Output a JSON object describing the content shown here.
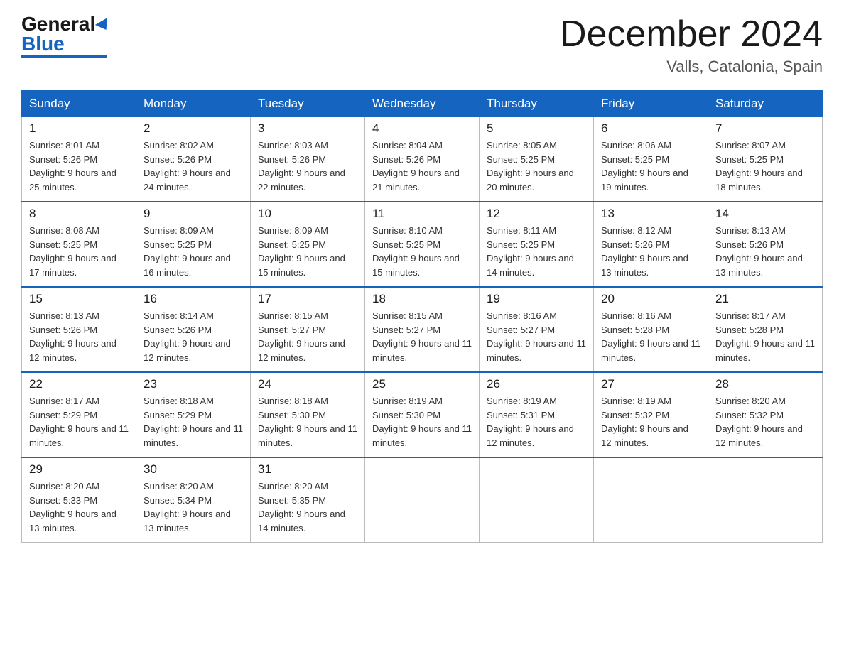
{
  "header": {
    "logo_general": "General",
    "logo_blue": "Blue",
    "month_title": "December 2024",
    "location": "Valls, Catalonia, Spain"
  },
  "weekdays": [
    "Sunday",
    "Monday",
    "Tuesday",
    "Wednesday",
    "Thursday",
    "Friday",
    "Saturday"
  ],
  "weeks": [
    [
      {
        "day": "1",
        "sunrise": "8:01 AM",
        "sunset": "5:26 PM",
        "daylight": "9 hours and 25 minutes."
      },
      {
        "day": "2",
        "sunrise": "8:02 AM",
        "sunset": "5:26 PM",
        "daylight": "9 hours and 24 minutes."
      },
      {
        "day": "3",
        "sunrise": "8:03 AM",
        "sunset": "5:26 PM",
        "daylight": "9 hours and 22 minutes."
      },
      {
        "day": "4",
        "sunrise": "8:04 AM",
        "sunset": "5:26 PM",
        "daylight": "9 hours and 21 minutes."
      },
      {
        "day": "5",
        "sunrise": "8:05 AM",
        "sunset": "5:25 PM",
        "daylight": "9 hours and 20 minutes."
      },
      {
        "day": "6",
        "sunrise": "8:06 AM",
        "sunset": "5:25 PM",
        "daylight": "9 hours and 19 minutes."
      },
      {
        "day": "7",
        "sunrise": "8:07 AM",
        "sunset": "5:25 PM",
        "daylight": "9 hours and 18 minutes."
      }
    ],
    [
      {
        "day": "8",
        "sunrise": "8:08 AM",
        "sunset": "5:25 PM",
        "daylight": "9 hours and 17 minutes."
      },
      {
        "day": "9",
        "sunrise": "8:09 AM",
        "sunset": "5:25 PM",
        "daylight": "9 hours and 16 minutes."
      },
      {
        "day": "10",
        "sunrise": "8:09 AM",
        "sunset": "5:25 PM",
        "daylight": "9 hours and 15 minutes."
      },
      {
        "day": "11",
        "sunrise": "8:10 AM",
        "sunset": "5:25 PM",
        "daylight": "9 hours and 15 minutes."
      },
      {
        "day": "12",
        "sunrise": "8:11 AM",
        "sunset": "5:25 PM",
        "daylight": "9 hours and 14 minutes."
      },
      {
        "day": "13",
        "sunrise": "8:12 AM",
        "sunset": "5:26 PM",
        "daylight": "9 hours and 13 minutes."
      },
      {
        "day": "14",
        "sunrise": "8:13 AM",
        "sunset": "5:26 PM",
        "daylight": "9 hours and 13 minutes."
      }
    ],
    [
      {
        "day": "15",
        "sunrise": "8:13 AM",
        "sunset": "5:26 PM",
        "daylight": "9 hours and 12 minutes."
      },
      {
        "day": "16",
        "sunrise": "8:14 AM",
        "sunset": "5:26 PM",
        "daylight": "9 hours and 12 minutes."
      },
      {
        "day": "17",
        "sunrise": "8:15 AM",
        "sunset": "5:27 PM",
        "daylight": "9 hours and 12 minutes."
      },
      {
        "day": "18",
        "sunrise": "8:15 AM",
        "sunset": "5:27 PM",
        "daylight": "9 hours and 11 minutes."
      },
      {
        "day": "19",
        "sunrise": "8:16 AM",
        "sunset": "5:27 PM",
        "daylight": "9 hours and 11 minutes."
      },
      {
        "day": "20",
        "sunrise": "8:16 AM",
        "sunset": "5:28 PM",
        "daylight": "9 hours and 11 minutes."
      },
      {
        "day": "21",
        "sunrise": "8:17 AM",
        "sunset": "5:28 PM",
        "daylight": "9 hours and 11 minutes."
      }
    ],
    [
      {
        "day": "22",
        "sunrise": "8:17 AM",
        "sunset": "5:29 PM",
        "daylight": "9 hours and 11 minutes."
      },
      {
        "day": "23",
        "sunrise": "8:18 AM",
        "sunset": "5:29 PM",
        "daylight": "9 hours and 11 minutes."
      },
      {
        "day": "24",
        "sunrise": "8:18 AM",
        "sunset": "5:30 PM",
        "daylight": "9 hours and 11 minutes."
      },
      {
        "day": "25",
        "sunrise": "8:19 AM",
        "sunset": "5:30 PM",
        "daylight": "9 hours and 11 minutes."
      },
      {
        "day": "26",
        "sunrise": "8:19 AM",
        "sunset": "5:31 PM",
        "daylight": "9 hours and 12 minutes."
      },
      {
        "day": "27",
        "sunrise": "8:19 AM",
        "sunset": "5:32 PM",
        "daylight": "9 hours and 12 minutes."
      },
      {
        "day": "28",
        "sunrise": "8:20 AM",
        "sunset": "5:32 PM",
        "daylight": "9 hours and 12 minutes."
      }
    ],
    [
      {
        "day": "29",
        "sunrise": "8:20 AM",
        "sunset": "5:33 PM",
        "daylight": "9 hours and 13 minutes."
      },
      {
        "day": "30",
        "sunrise": "8:20 AM",
        "sunset": "5:34 PM",
        "daylight": "9 hours and 13 minutes."
      },
      {
        "day": "31",
        "sunrise": "8:20 AM",
        "sunset": "5:35 PM",
        "daylight": "9 hours and 14 minutes."
      },
      null,
      null,
      null,
      null
    ]
  ]
}
